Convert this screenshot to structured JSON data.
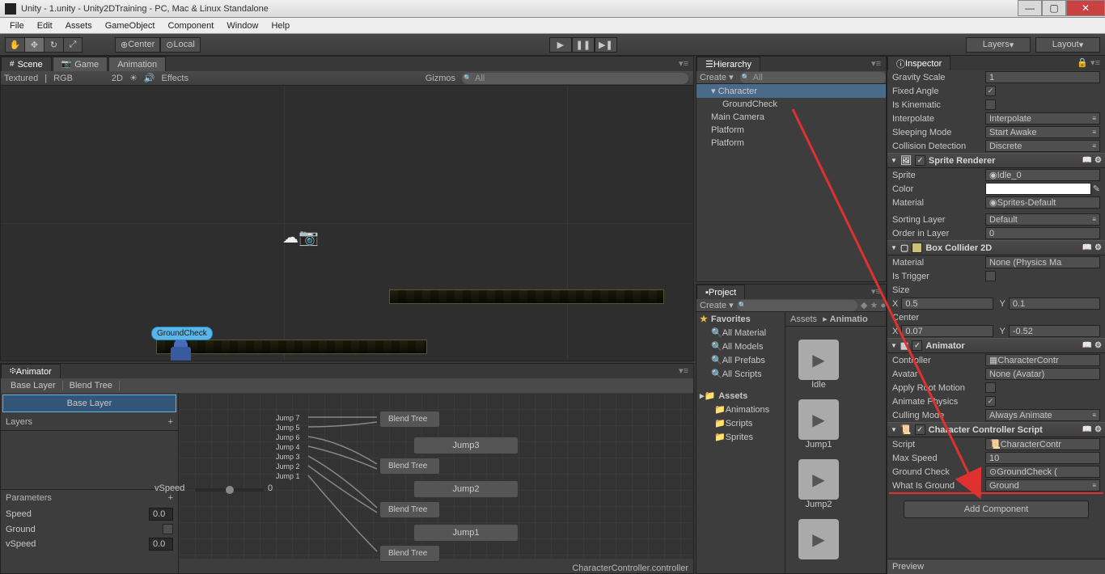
{
  "window": {
    "title": "Unity - 1.unity - Unity2DTraining - PC, Mac & Linux Standalone"
  },
  "menu": [
    "File",
    "Edit",
    "Assets",
    "GameObject",
    "Component",
    "Window",
    "Help"
  ],
  "toolbar": {
    "pivot": "Center",
    "space": "Local",
    "layers": "Layers",
    "layout": "Layout"
  },
  "scene_tabs": [
    {
      "label": "Scene",
      "icon": "#"
    },
    {
      "label": "Game",
      "icon": "📷"
    },
    {
      "label": "Animation",
      "icon": ""
    }
  ],
  "scene_ctrl": {
    "shading": "Textured",
    "mode": "RGB",
    "dim": "2D",
    "effects": "Effects",
    "gizmos": "Gizmos",
    "search": "All"
  },
  "scene_objects": {
    "groundcheck_label": "GroundCheck"
  },
  "animator": {
    "tab": "Animator",
    "breadcrumb": [
      "Base Layer",
      "Blend Tree"
    ],
    "layer_item": "Base Layer",
    "layers_label": "Layers",
    "params_label": "Parameters",
    "params": [
      {
        "name": "Speed",
        "value": "0.0"
      },
      {
        "name": "Ground",
        "value": ""
      },
      {
        "name": "vSpeed",
        "value": "0.0"
      }
    ],
    "vspeed_label": "vSpeed",
    "vspeed_val": "0",
    "jump_labels": [
      "Jump 7",
      "Jump 5",
      "Jump 6",
      "Jump 4",
      "Jump 3",
      "Jump 2",
      "Jump 1"
    ],
    "nodes": [
      "Blend Tree",
      "Jump3",
      "Blend Tree",
      "Jump2",
      "Blend Tree",
      "Jump1",
      "Blend Tree"
    ],
    "footer": "CharacterController.controller"
  },
  "hierarchy": {
    "tab": "Hierarchy",
    "create": "Create",
    "search": "All",
    "items": [
      {
        "label": "Character",
        "sel": true,
        "child": false
      },
      {
        "label": "GroundCheck",
        "sel": false,
        "child": true
      },
      {
        "label": "Main Camera",
        "sel": false,
        "child": false
      },
      {
        "label": "Platform",
        "sel": false,
        "child": false
      },
      {
        "label": "Platform",
        "sel": false,
        "child": false
      }
    ]
  },
  "project": {
    "tab": "Project",
    "create": "Create",
    "favorites": "Favorites",
    "fav_items": [
      "All Material",
      "All Models",
      "All Prefabs",
      "All Scripts"
    ],
    "assets": "Assets",
    "asset_dirs": [
      "Animations",
      "Scripts",
      "Sprites"
    ],
    "breadcrumb": [
      "Assets",
      "Animatio"
    ],
    "thumbs": [
      "Idle",
      "Jump1",
      "Jump2",
      ""
    ]
  },
  "inspector": {
    "tab": "Inspector",
    "props": [
      {
        "label": "Gravity Scale",
        "value": "1",
        "type": "fld"
      },
      {
        "label": "Fixed Angle",
        "value": "✓",
        "type": "chk"
      },
      {
        "label": "Is Kinematic",
        "value": "",
        "type": "chk"
      },
      {
        "label": "Interpolate",
        "value": "Interpolate",
        "type": "dd"
      },
      {
        "label": "Sleeping Mode",
        "value": "Start Awake",
        "type": "dd"
      },
      {
        "label": "Collision Detection",
        "value": "Discrete",
        "type": "dd"
      }
    ],
    "sprite_renderer": {
      "title": "Sprite Renderer",
      "rows": [
        {
          "label": "Sprite",
          "value": "Idle_0",
          "type": "fld"
        },
        {
          "label": "Color",
          "value": "",
          "type": "color"
        },
        {
          "label": "Material",
          "value": "Sprites-Default",
          "type": "fld"
        },
        {
          "label": "Sorting Layer",
          "value": "Default",
          "type": "dd"
        },
        {
          "label": "Order in Layer",
          "value": "0",
          "type": "fld"
        }
      ]
    },
    "box_collider": {
      "title": "Box Collider 2D",
      "rows": [
        {
          "label": "Material",
          "value": "None (Physics Ma",
          "type": "fld"
        },
        {
          "label": "Is Trigger",
          "value": "",
          "type": "chk"
        }
      ],
      "size_label": "Size",
      "size_x": "0.5",
      "size_y": "0.1",
      "center_label": "Center",
      "center_x": "0.07",
      "center_y": "-0.52"
    },
    "animator_comp": {
      "title": "Animator",
      "rows": [
        {
          "label": "Controller",
          "value": "CharacterContr",
          "type": "fld"
        },
        {
          "label": "Avatar",
          "value": "None (Avatar)",
          "type": "fld"
        },
        {
          "label": "Apply Root Motion",
          "value": "",
          "type": "chk"
        },
        {
          "label": "Animate Physics",
          "value": "✓",
          "type": "chk"
        },
        {
          "label": "Culling Mode",
          "value": "Always Animate",
          "type": "dd"
        }
      ]
    },
    "char_ctrl": {
      "title": "Character Controller Script",
      "rows": [
        {
          "label": "Script",
          "value": "CharacterContr",
          "type": "fld"
        },
        {
          "label": "Max Speed",
          "value": "10",
          "type": "fld"
        },
        {
          "label": "Ground Check",
          "value": "GroundCheck (",
          "type": "fld"
        },
        {
          "label": "What Is Ground",
          "value": "Ground",
          "type": "dd"
        }
      ]
    },
    "add_component": "Add Component",
    "preview": "Preview"
  }
}
